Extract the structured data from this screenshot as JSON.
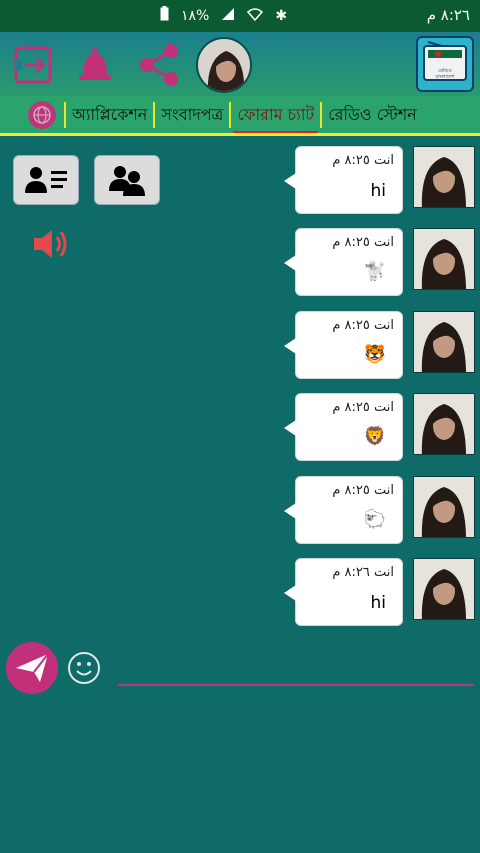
{
  "status_bar": {
    "time": "٨:٢٦ م",
    "battery": "%١٨",
    "icons": [
      "battery-icon",
      "signal-icon",
      "wifi-icon",
      "bluetooth-icon"
    ]
  },
  "app_bar": {
    "icons": [
      "exit-icon",
      "bell-icon",
      "share-icon",
      "radio-icon"
    ],
    "radio_badge_text": "রেডিও বাংলাদেশ"
  },
  "tabs": [
    {
      "label": "অ্যাপ্লিকেশন",
      "active": false
    },
    {
      "label": "সংবাদপত্র",
      "active": false
    },
    {
      "label": "ফোরাম চ্যাট",
      "active": true
    },
    {
      "label": "রেডিও স্টেশন",
      "active": false
    }
  ],
  "actions": {
    "icons": [
      "contact-card-icon",
      "group-users-icon",
      "speaker-icon"
    ]
  },
  "messages": [
    {
      "sender": "انت",
      "time": "٨:٢٥ م",
      "text": "hi",
      "emoji": false
    },
    {
      "sender": "انت",
      "time": "٨:٢٥ م",
      "text": "🐩",
      "emoji": true
    },
    {
      "sender": "انت",
      "time": "٨:٢٥ م",
      "text": "🐯",
      "emoji": true
    },
    {
      "sender": "انت",
      "time": "٨:٢٥ م",
      "text": "🦁",
      "emoji": true
    },
    {
      "sender": "انت",
      "time": "٨:٢٥ م",
      "text": "🐑",
      "emoji": true
    },
    {
      "sender": "انت",
      "time": "٨:٢٦ م",
      "text": "hi",
      "emoji": false
    }
  ],
  "composer": {
    "value": "",
    "icons": [
      "send-icon",
      "smiley-icon"
    ]
  },
  "colors": {
    "background": "#0f6b67",
    "status_bar": "#0b5a31",
    "tab_bar": "#2aa36c",
    "tab_underline": "#f2ec2c",
    "active_tab_indicator": "#e21f1f",
    "accent": "#c2307a"
  }
}
